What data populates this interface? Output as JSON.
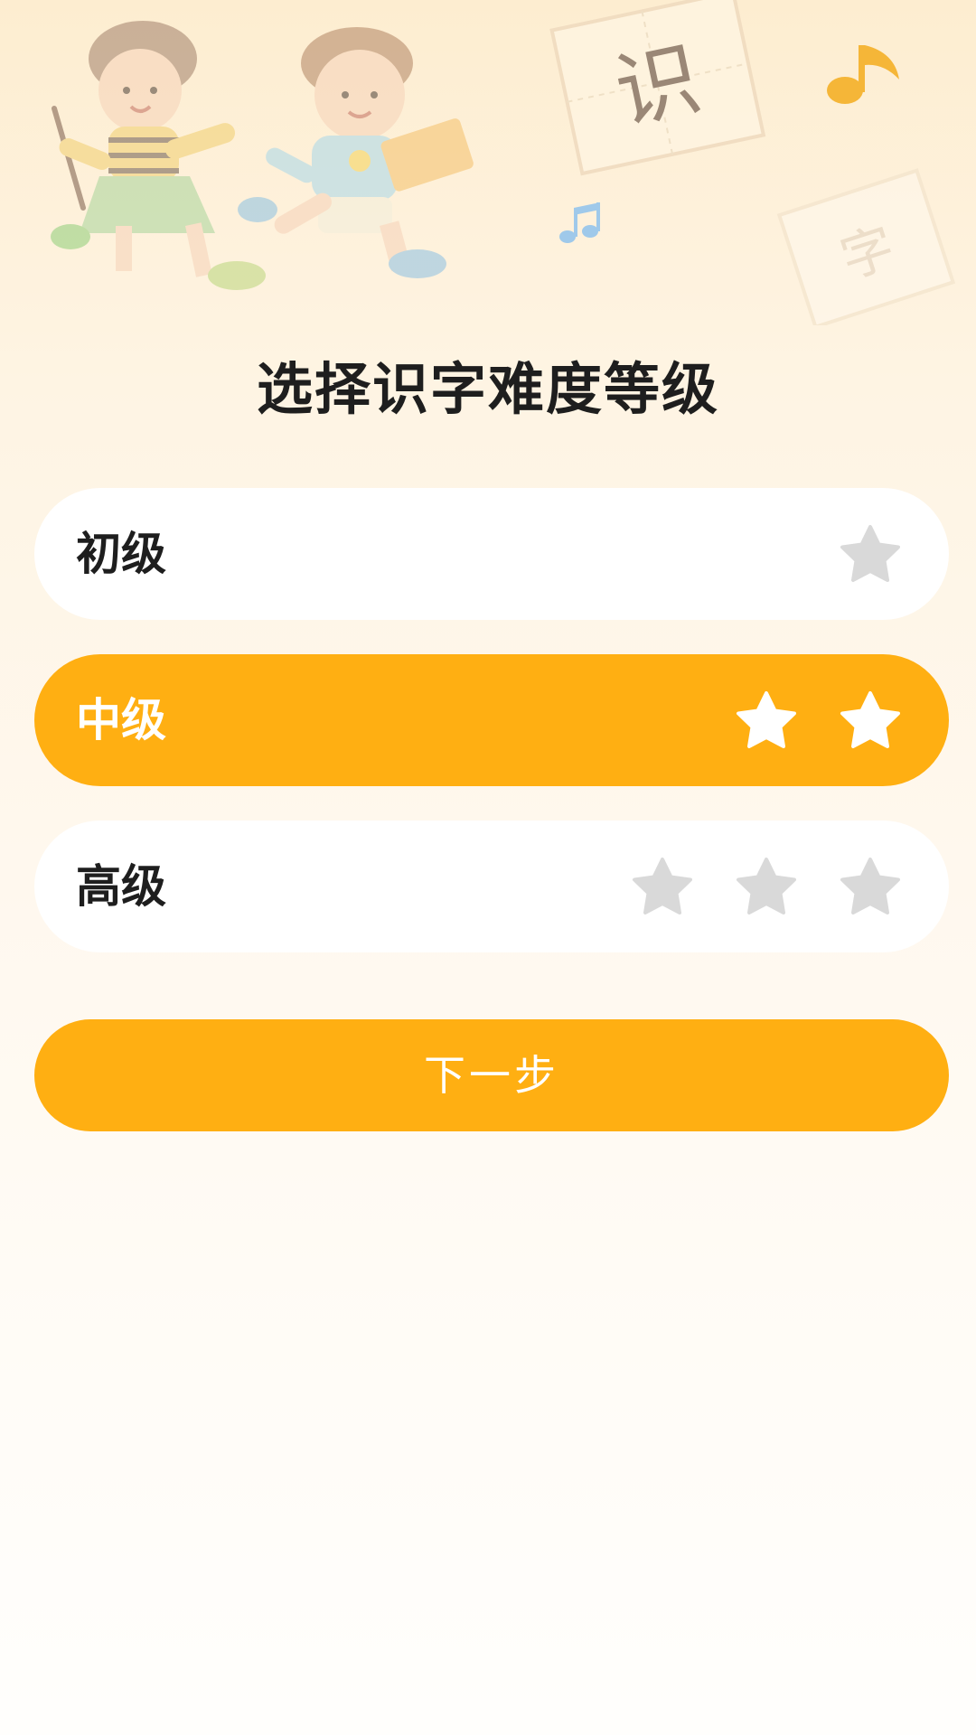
{
  "header": {
    "title": "选择识字难度等级",
    "illustration": {
      "char_large": "识",
      "char_small": "字",
      "icons": [
        "girl-running-figure",
        "boy-running-figure",
        "music-note-icon",
        "double-music-note-icon"
      ]
    }
  },
  "levels": [
    {
      "label": "初级",
      "stars": 1,
      "selected": false
    },
    {
      "label": "中级",
      "stars": 2,
      "selected": true
    },
    {
      "label": "高级",
      "stars": 3,
      "selected": false
    }
  ],
  "next_button": {
    "label": "下一步"
  },
  "colors": {
    "accent": "#ffaf12",
    "star_inactive": "#d9d9d9",
    "star_active": "#ffffff",
    "title_text": "#1e1e1e",
    "card_bg": "#ffffff"
  }
}
